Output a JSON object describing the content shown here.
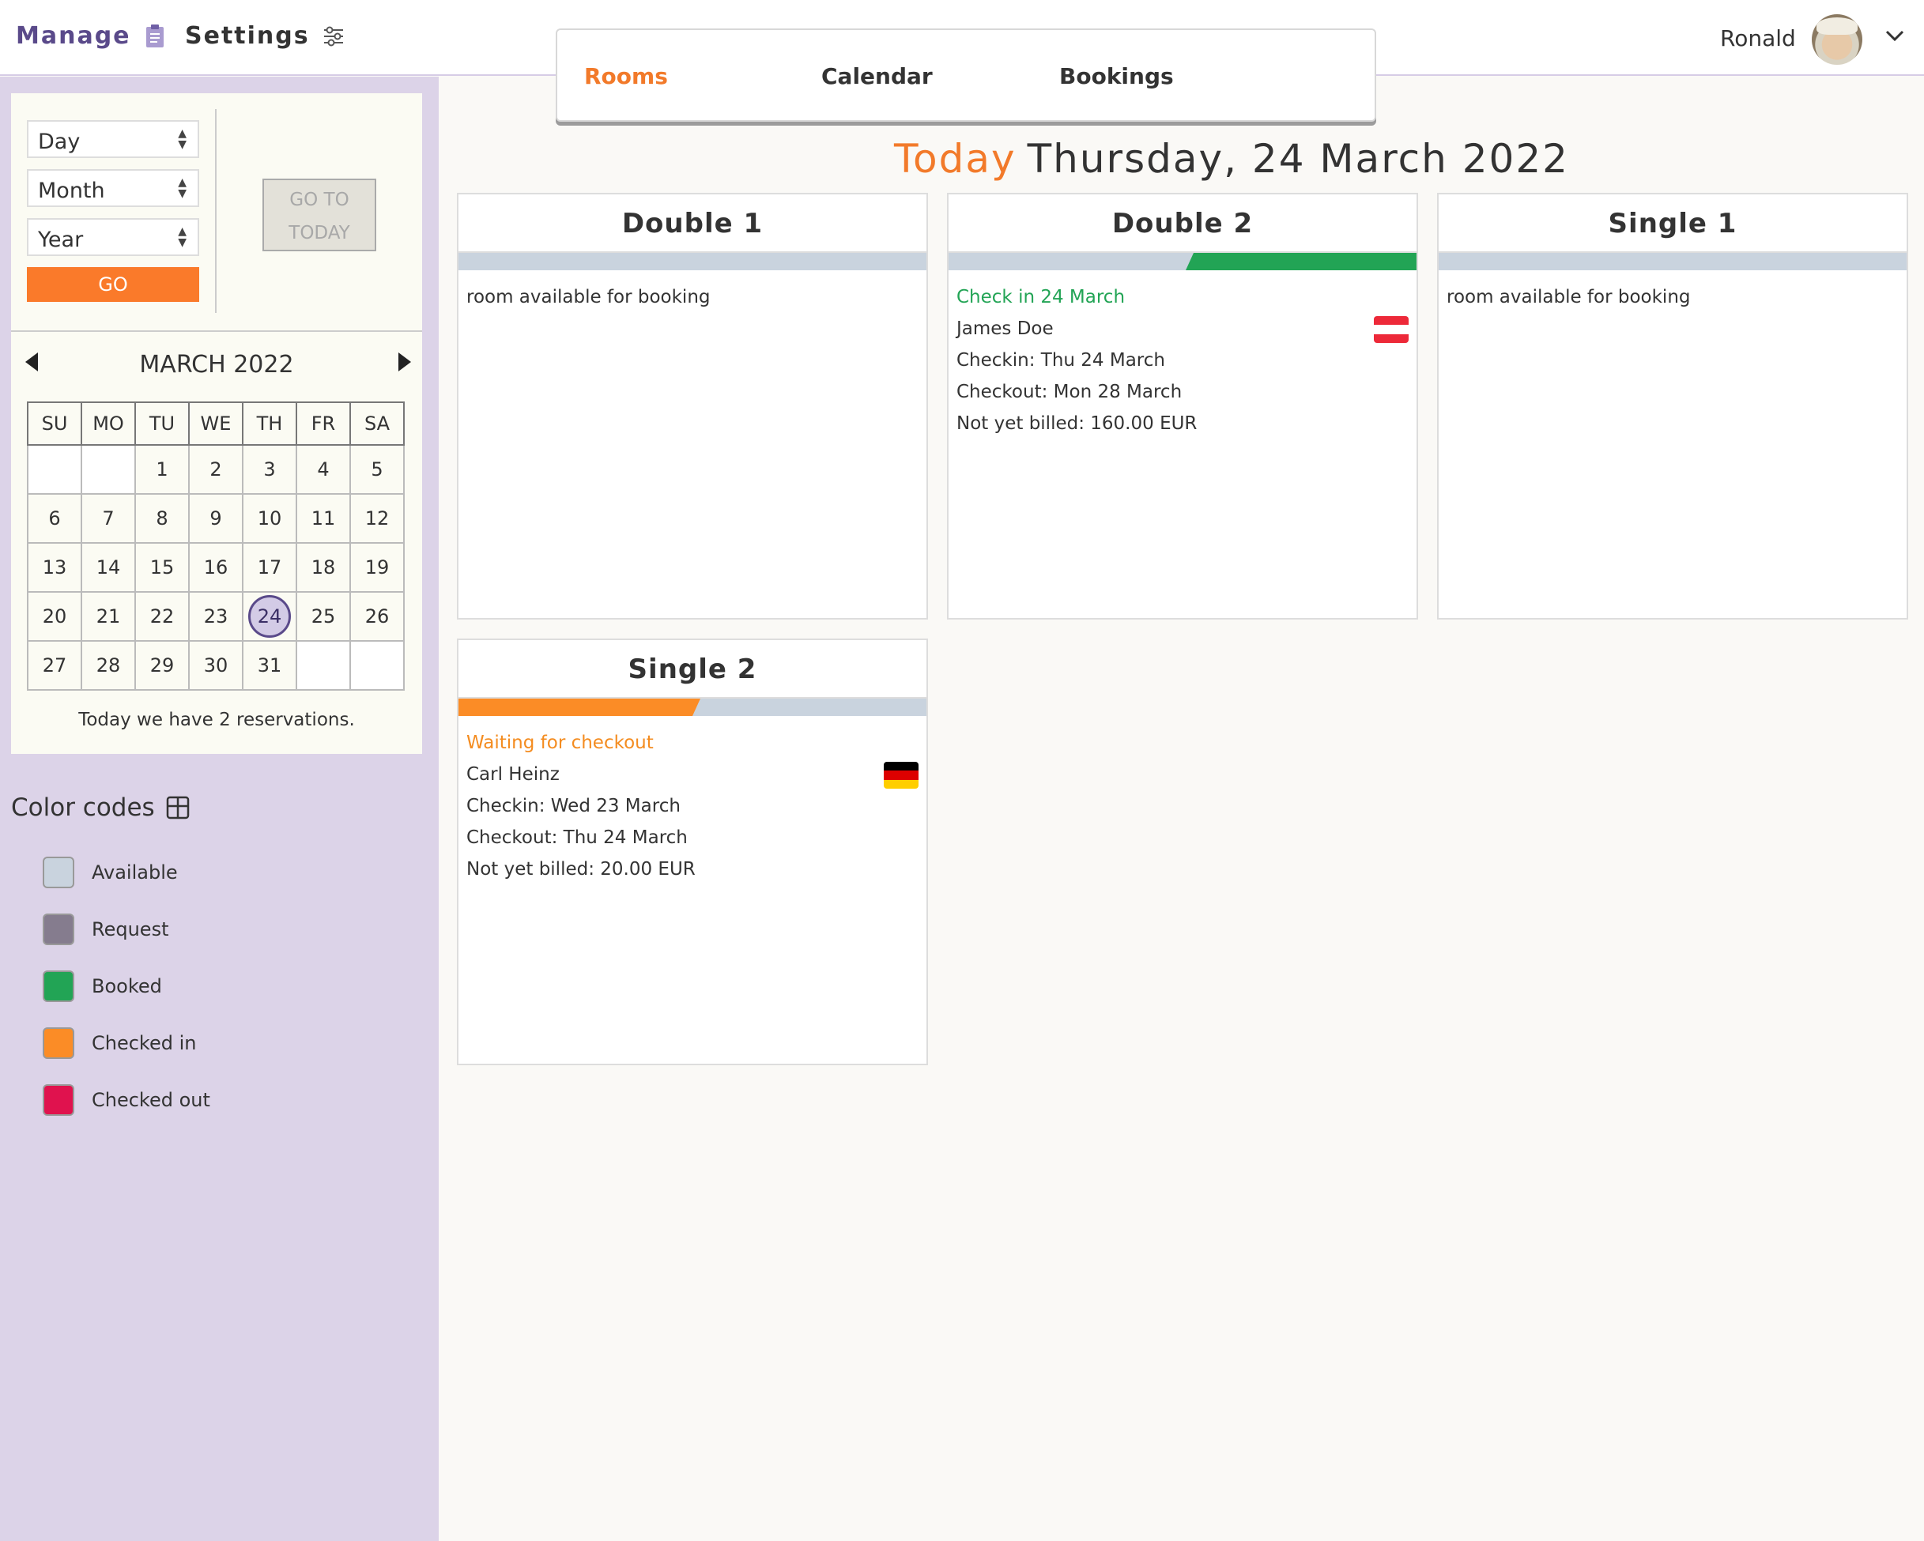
{
  "header": {
    "manage_label": "Manage",
    "settings_label": "Settings",
    "user_name": "Ronald"
  },
  "nav": {
    "rooms": "Rooms",
    "calendar": "Calendar",
    "bookings": "Bookings",
    "active": "Rooms"
  },
  "filters": {
    "day_placeholder": "Day",
    "month_placeholder": "Month",
    "year_placeholder": "Year",
    "go_label": "GO",
    "goto_today_line1": "GO TO",
    "goto_today_line2": "TODAY"
  },
  "calendar": {
    "title": "MARCH 2022",
    "weekdays": [
      "SU",
      "MO",
      "TU",
      "WE",
      "TH",
      "FR",
      "SA"
    ],
    "weeks": [
      [
        "",
        "",
        "1",
        "2",
        "3",
        "4",
        "5"
      ],
      [
        "6",
        "7",
        "8",
        "9",
        "10",
        "11",
        "12"
      ],
      [
        "13",
        "14",
        "15",
        "16",
        "17",
        "18",
        "19"
      ],
      [
        "20",
        "21",
        "22",
        "23",
        "24",
        "25",
        "26"
      ],
      [
        "27",
        "28",
        "29",
        "30",
        "31",
        "",
        ""
      ]
    ],
    "today": "24",
    "reservation_note": "Today we have 2 reservations."
  },
  "color_codes": {
    "title": "Color codes",
    "items": [
      {
        "label": "Available",
        "color": "#c9d3de"
      },
      {
        "label": "Request",
        "color": "#857c8e"
      },
      {
        "label": "Booked",
        "color": "#22a455"
      },
      {
        "label": "Checked in",
        "color": "#fb8c26"
      },
      {
        "label": "Checked out",
        "color": "#e0124e"
      }
    ]
  },
  "today_heading": {
    "today_word": "Today",
    "date": "Thursday, 24 March 2022"
  },
  "rooms": [
    {
      "name": "Double 1",
      "status_text": "room available for booking"
    },
    {
      "name": "Double 2",
      "status_text": "Check in 24 March",
      "status_color": "#22a455",
      "guest": "James Doe",
      "flag": "austria-flag",
      "checkin": "Checkin: Thu 24 March",
      "checkout": "Checkout: Mon 28 March",
      "billing": "Not yet billed: 160.00 EUR"
    },
    {
      "name": "Single 1",
      "status_text": "room available for booking"
    },
    {
      "name": "Single 2",
      "status_text": "Waiting for checkout",
      "status_color": "#f48c20",
      "guest": "Carl Heinz",
      "flag": "germany-flag",
      "checkin": "Checkin: Wed 23 March",
      "checkout": "Checkout: Thu 24 March",
      "billing": "Not yet billed: 20.00 EUR"
    }
  ]
}
